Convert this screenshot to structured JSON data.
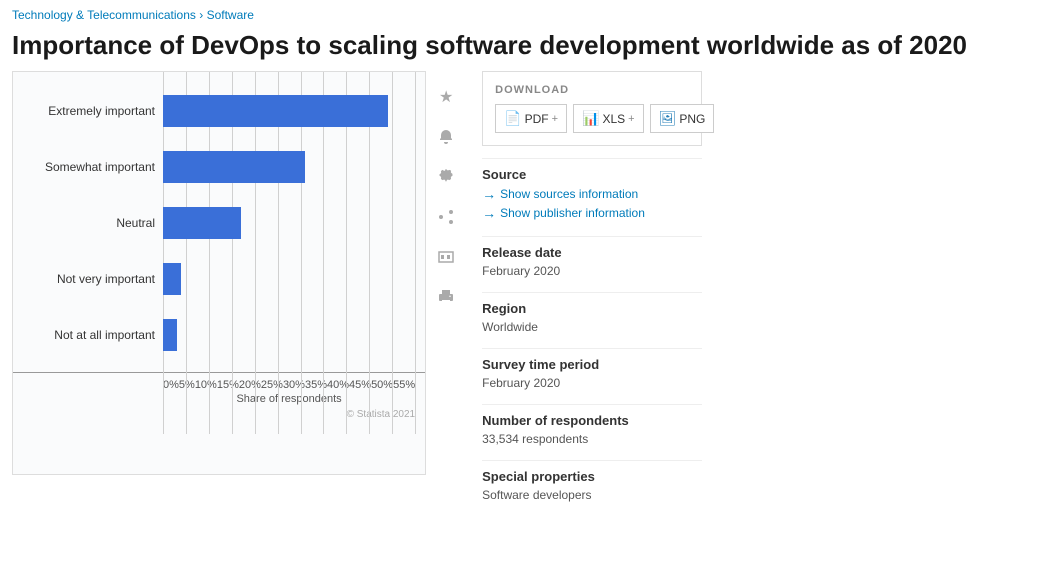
{
  "breadcrumb": {
    "part1": "Technology & Telecommunications",
    "separator": "›",
    "part2": "Software"
  },
  "title": "Importance of DevOps to scaling software development worldwide as of 2020",
  "chart": {
    "bars": [
      {
        "label": "Extremely important",
        "value": 49,
        "maxPercent": 55
      },
      {
        "label": "Somewhat important",
        "value": 31,
        "maxPercent": 55
      },
      {
        "label": "Neutral",
        "value": 17,
        "maxPercent": 55
      },
      {
        "label": "Not very important",
        "value": 4,
        "maxPercent": 55
      },
      {
        "label": "Not at all important",
        "value": 3,
        "maxPercent": 55
      }
    ],
    "xTicks": [
      "0%",
      "5%",
      "10%",
      "15%",
      "20%",
      "25%",
      "30%",
      "35%",
      "40%",
      "45%",
      "50%",
      "55%"
    ],
    "xAxisLabel": "Share of respondents",
    "maxValue": 55
  },
  "actions": {
    "star": "★",
    "bell": "🔔",
    "gear": "⚙",
    "share": "↗",
    "quote": "❝",
    "print": "🖨"
  },
  "download": {
    "title": "DOWNLOAD",
    "pdf_label": "PDF",
    "xls_label": "XLS",
    "png_label": "PNG"
  },
  "sidebar": {
    "source_label": "Source",
    "show_sources": "Show sources information",
    "show_publisher": "Show publisher information",
    "release_date_label": "Release date",
    "release_date_value": "February 2020",
    "region_label": "Region",
    "region_value": "Worldwide",
    "survey_period_label": "Survey time period",
    "survey_period_value": "February 2020",
    "respondents_label": "Number of respondents",
    "respondents_value": "33,534 respondents",
    "special_label": "Special properties",
    "special_value": "Software developers"
  },
  "copyright": "© Statista 2021"
}
